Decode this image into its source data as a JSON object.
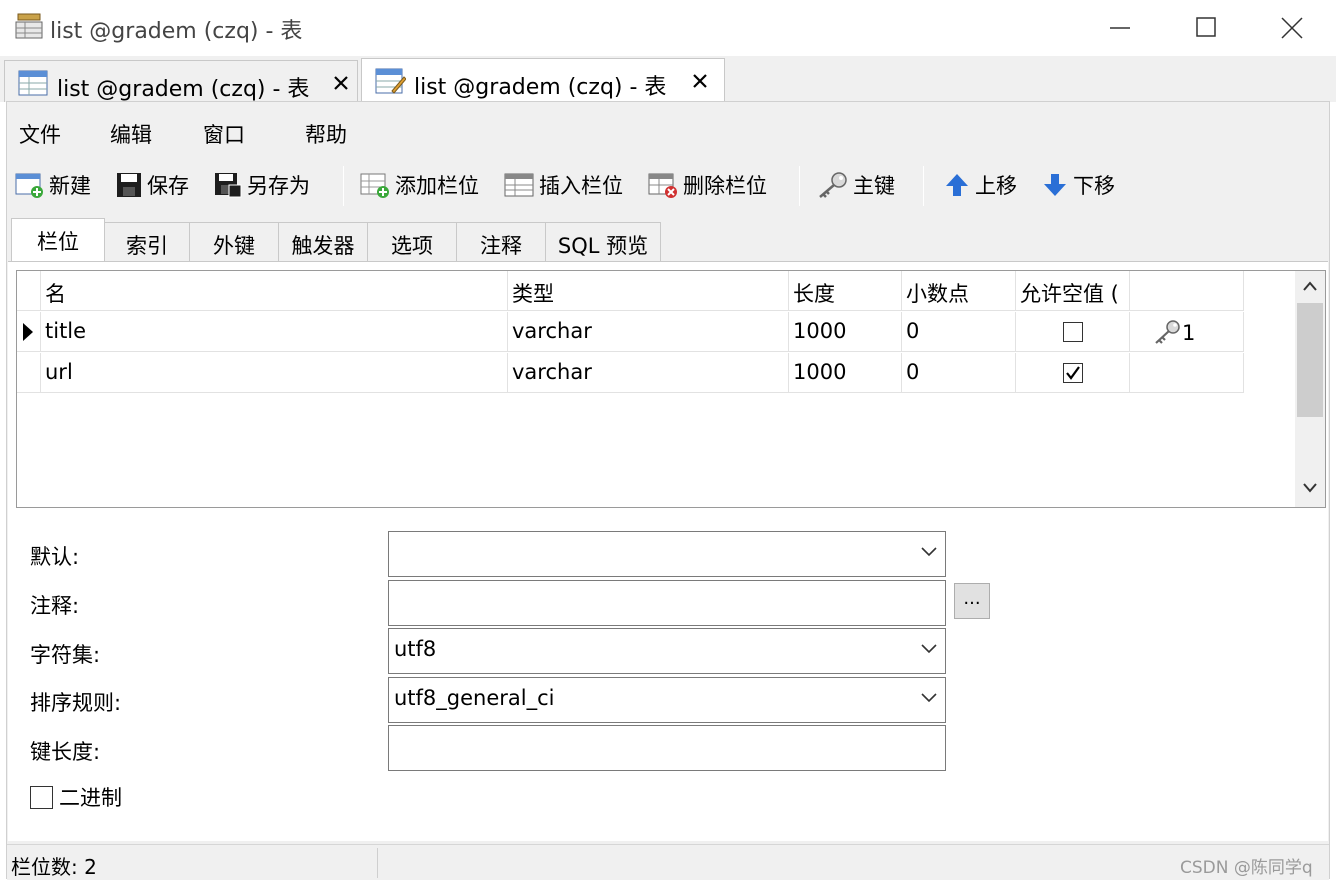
{
  "window": {
    "title": "list @gradem (czq) - 表"
  },
  "doc_tabs": [
    {
      "label": "list @gradem (czq) - 表"
    },
    {
      "label": "list @gradem (czq) - 表"
    }
  ],
  "menu": [
    "文件",
    "编辑",
    "窗口",
    "帮助"
  ],
  "toolbar": {
    "new": "新建",
    "save": "保存",
    "save_as": "另存为",
    "add_field": "添加栏位",
    "insert_field": "插入栏位",
    "delete_field": "删除栏位",
    "primary_key": "主键",
    "move_up": "上移",
    "move_down": "下移"
  },
  "subtabs": [
    "栏位",
    "索引",
    "外键",
    "触发器",
    "选项",
    "注释",
    "SQL 预览"
  ],
  "grid": {
    "headers": [
      "名",
      "类型",
      "长度",
      "小数点",
      "允许空值 (",
      ""
    ],
    "rows": [
      {
        "name": "title",
        "type": "varchar",
        "length": "1000",
        "decimals": "0",
        "nullable": false,
        "key": "1"
      },
      {
        "name": "url",
        "type": "varchar",
        "length": "1000",
        "decimals": "0",
        "nullable": true,
        "key": ""
      }
    ]
  },
  "props": {
    "default_label": "默认:",
    "default_value": "",
    "comment_label": "注释:",
    "comment_value": "",
    "comment_button": "...",
    "charset_label": "字符集:",
    "charset_value": "utf8",
    "collation_label": "排序规则:",
    "collation_value": "utf8_general_ci",
    "key_length_label": "键长度:",
    "key_length_value": "",
    "binary_label": "二进制",
    "binary_checked": false
  },
  "status": {
    "text": "栏位数: 2"
  },
  "watermark": "CSDN @陈同学q",
  "colors": {
    "accent_blue": "#2a6fd6",
    "selected_tab": "#ffffff",
    "chrome": "#f0f0f0"
  }
}
